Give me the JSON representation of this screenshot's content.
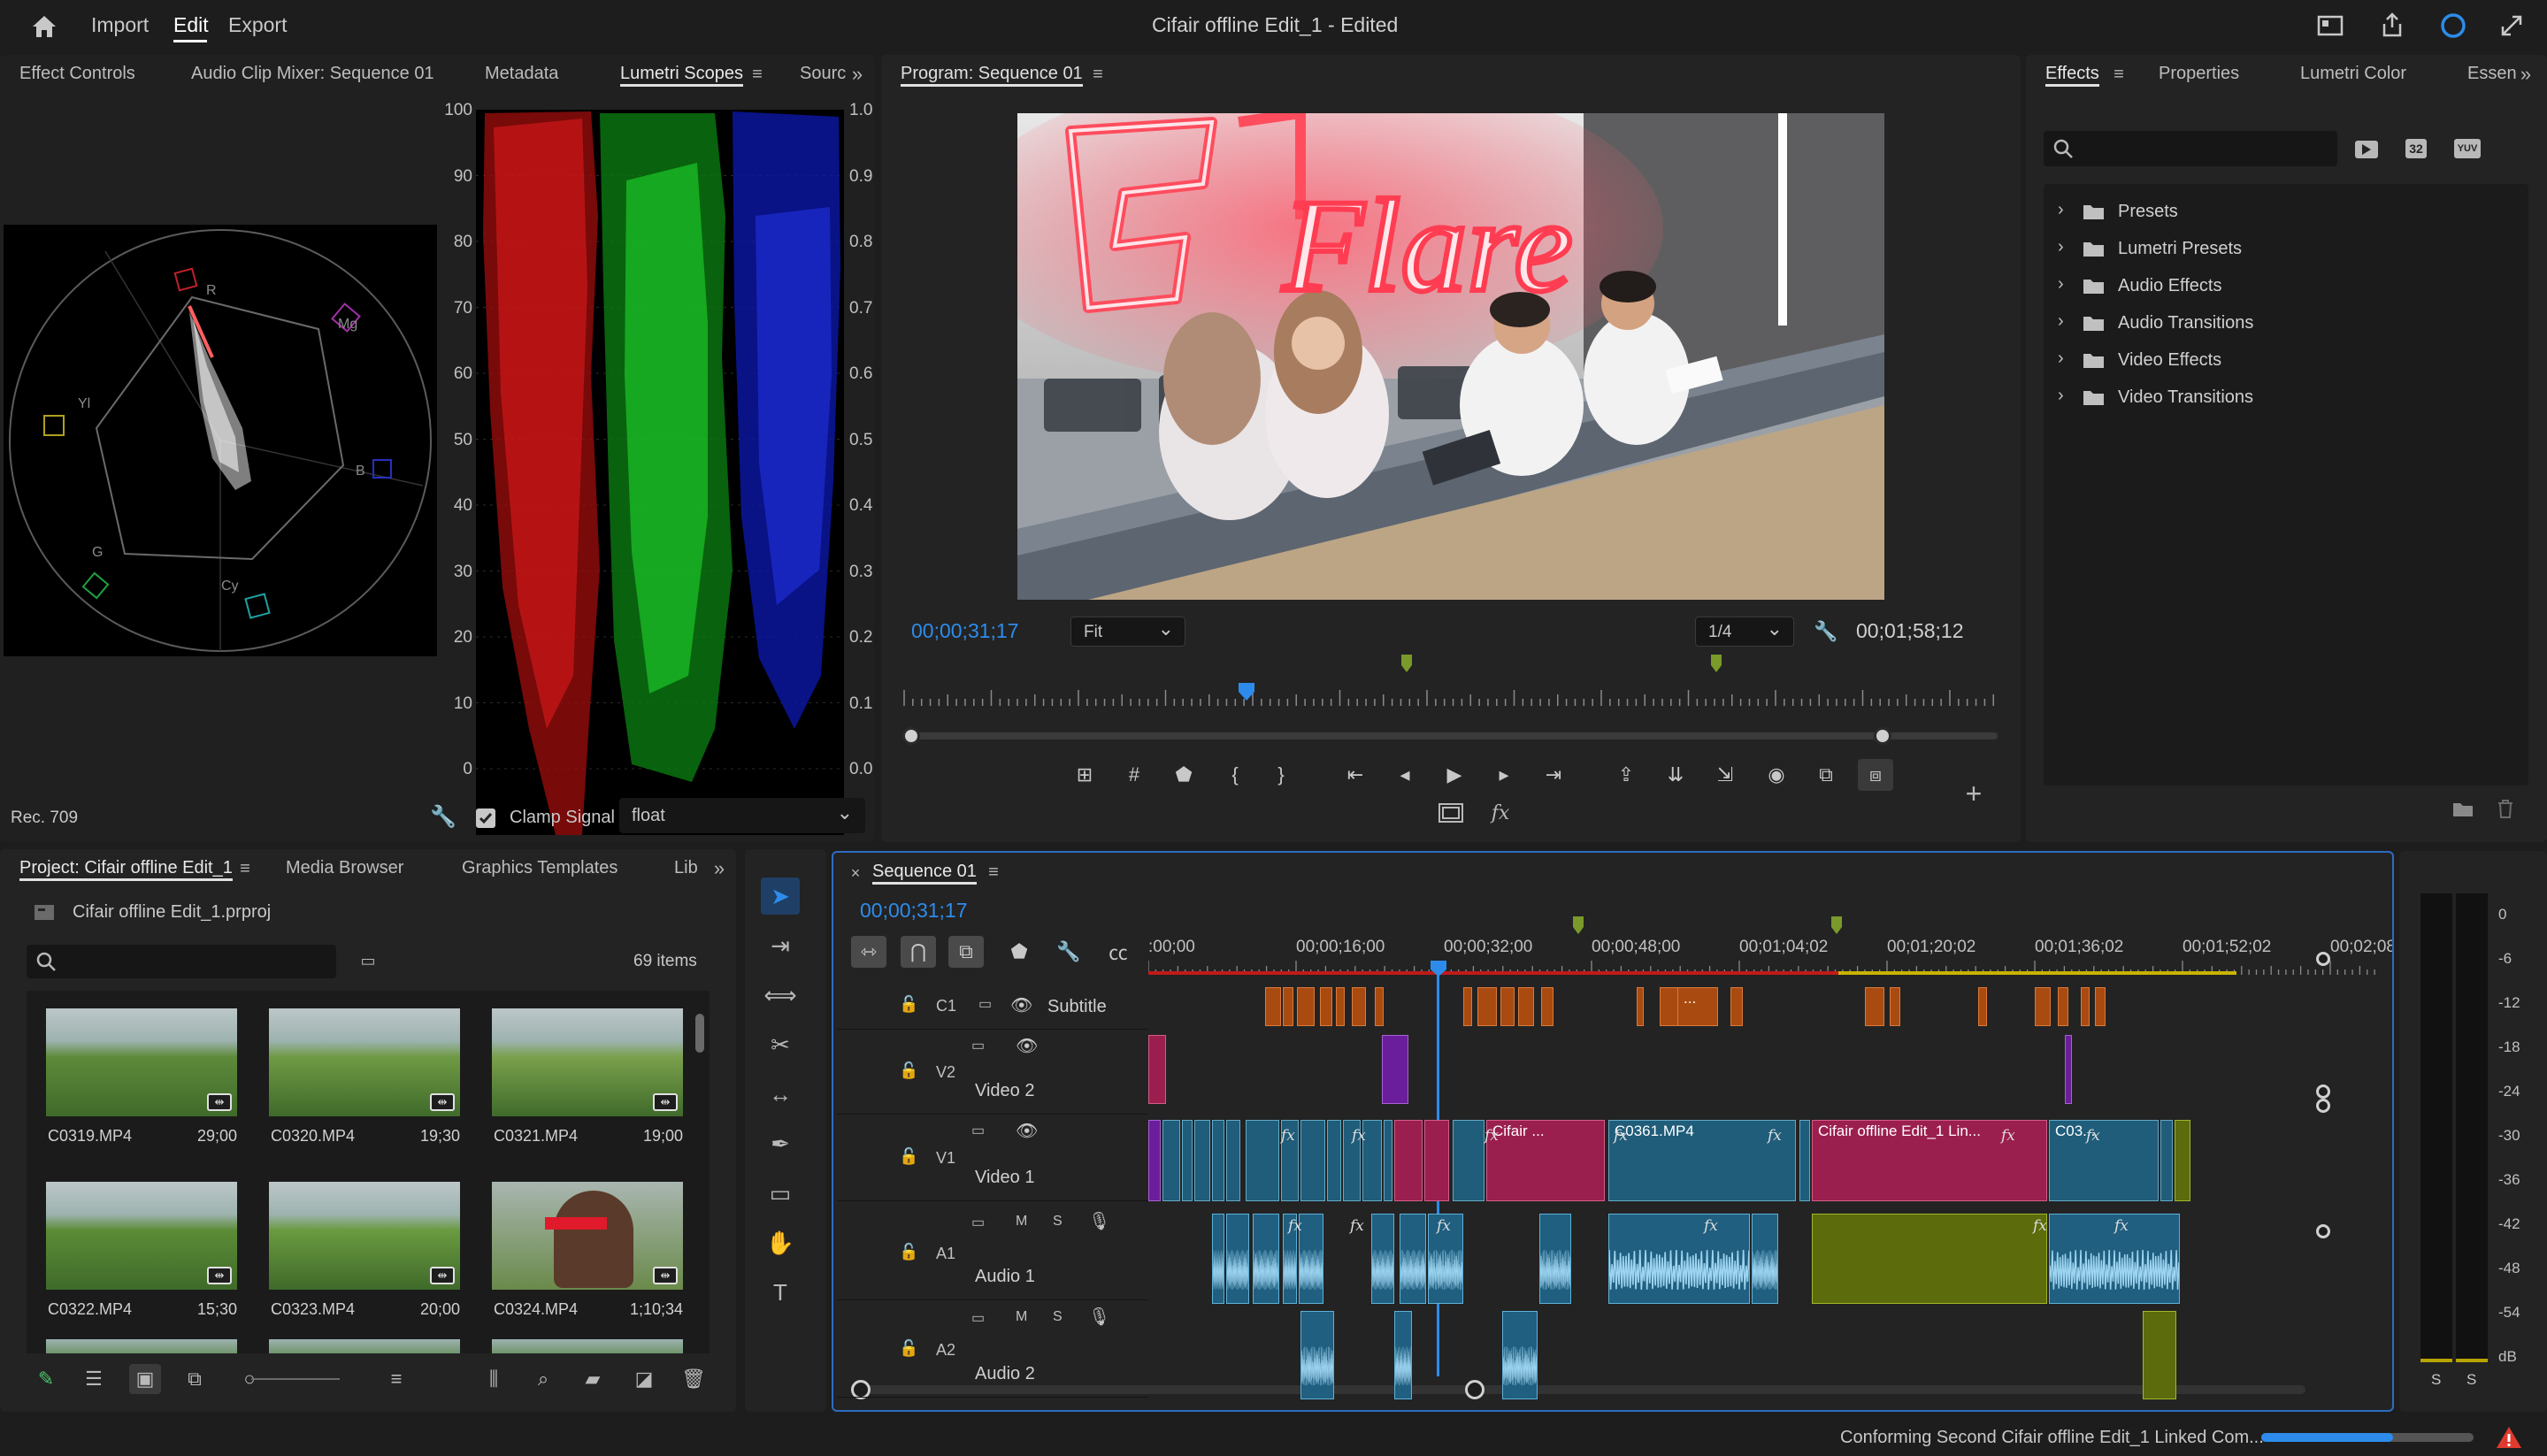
{
  "menu": {
    "import": "Import",
    "edit": "Edit",
    "export": "Export",
    "title": "Cifair offline Edit_1 - Edited"
  },
  "source_panel": {
    "tabs": [
      "Effect Controls",
      "Audio Clip Mixer: Sequence 01",
      "Metadata",
      "Lumetri Scopes",
      "Sourc"
    ],
    "scale_left": [
      "100",
      "90",
      "80",
      "70",
      "60",
      "50",
      "40",
      "30",
      "20",
      "10",
      "0"
    ],
    "scale_right": [
      "1.0",
      "0.9",
      "0.8",
      "0.7",
      "0.6",
      "0.5",
      "0.4",
      "0.3",
      "0.2",
      "0.1",
      "0.0"
    ],
    "vector_labels": {
      "r": "R",
      "mg": "Mg",
      "yl": "Yl",
      "b": "B",
      "g": "G",
      "cy": "Cy"
    },
    "footer_left": "Rec. 709",
    "clamp_label": "Clamp Signal",
    "clamp_value": "float"
  },
  "program": {
    "title": "Program: Sequence 01",
    "timecode_in": "00;00;31;17",
    "fit": "Fit",
    "res": "1/4",
    "timecode_out": "00;01;58;12",
    "neon_text": "Flare"
  },
  "effects_panel": {
    "tabs": [
      "Effects",
      "Properties",
      "Lumetri Color",
      "Essen"
    ],
    "badge_32": "32",
    "badge_yuv": "YUV",
    "items": [
      "Presets",
      "Lumetri Presets",
      "Audio Effects",
      "Audio Transitions",
      "Video Effects",
      "Video Transitions"
    ]
  },
  "project": {
    "tabs": [
      "Project: Cifair offline Edit_1",
      "Media Browser",
      "Graphics Templates",
      "Lib"
    ],
    "file": "Cifair offline Edit_1.prproj",
    "count": "69 items",
    "clips": [
      {
        "name": "C0319.MP4",
        "dur": "29;00"
      },
      {
        "name": "C0320.MP4",
        "dur": "19;30"
      },
      {
        "name": "C0321.MP4",
        "dur": "19;00"
      },
      {
        "name": "C0322.MP4",
        "dur": "15;30"
      },
      {
        "name": "C0323.MP4",
        "dur": "20;00"
      },
      {
        "name": "C0324.MP4",
        "dur": "1;10;34"
      }
    ]
  },
  "timeline": {
    "title": "Sequence 01",
    "timecode": "00;00;31;17",
    "ruler": [
      ":00;00",
      "00;00;16;00",
      "00;00;32;00",
      "00;00;48;00",
      "00;01;04;02",
      "00;01;20;02",
      "00;01;36;02",
      "00;01;52;02",
      "00;02;08;0"
    ],
    "tracks": [
      {
        "id": "C1",
        "name": "Subtitle"
      },
      {
        "id": "V2",
        "name": "Video 2"
      },
      {
        "id": "V1",
        "name": "Video 1"
      },
      {
        "id": "A1",
        "name": "Audio 1"
      },
      {
        "id": "A2",
        "name": "Audio 2"
      }
    ],
    "m_label": "M",
    "s_label": "S",
    "fx": "fx",
    "clip_names": {
      "c1": "Cifair ...",
      "c2": "C0361.MP4",
      "c3": "Cifair offline Edit_1 Lin...",
      "c4": "C03..."
    },
    "subtitle_dots": "..."
  },
  "meter": {
    "scale": [
      "0",
      "-6",
      "-12",
      "-18",
      "-24",
      "-30",
      "-36",
      "-42",
      "-48",
      "-54",
      "dB"
    ],
    "s1": "S",
    "s2": "S"
  },
  "status": {
    "text": "Conforming Second Cifair offline Edit_1 Linked Com...",
    "progress": 0.62
  },
  "colors": {
    "accent": "#2d8ceb",
    "clip_video": "#1f5d7a",
    "clip_pink": "#9b1f4e",
    "clip_audio": "#205f80",
    "clip_yellow": "#5c6b0c",
    "clip_orange": "#a94b11"
  }
}
